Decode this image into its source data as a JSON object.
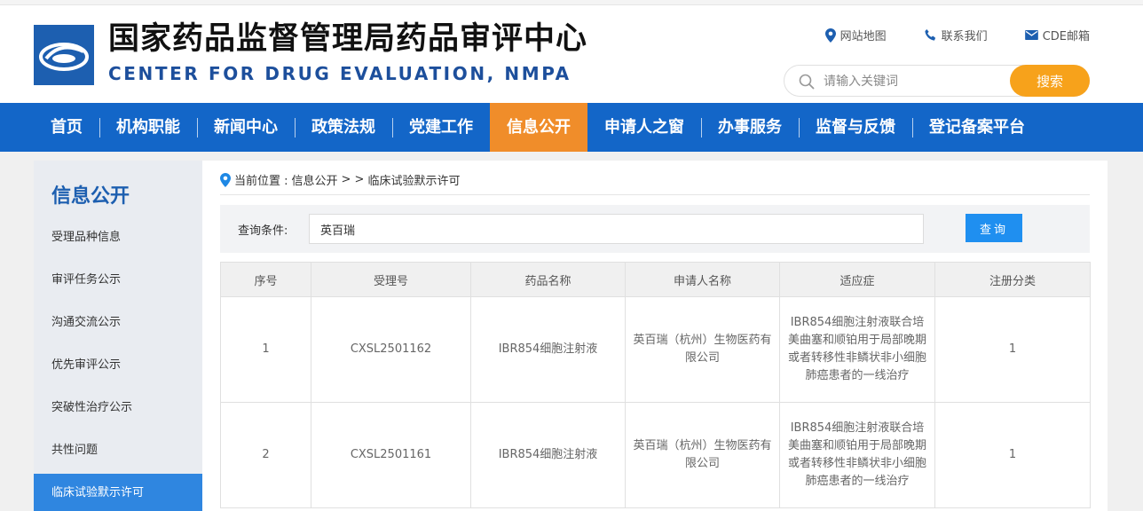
{
  "header": {
    "title_cn": "国家药品监督管理局药品审评中心",
    "title_en": "CENTER FOR DRUG EVALUATION, NMPA",
    "links": [
      {
        "label": "网站地图",
        "icon": "map-pin-icon"
      },
      {
        "label": "联系我们",
        "icon": "phone-icon"
      },
      {
        "label": "CDE邮箱",
        "icon": "mail-icon"
      }
    ],
    "search": {
      "placeholder": "请输入关键词",
      "button": "搜索"
    }
  },
  "nav": {
    "items": [
      "首页",
      "机构职能",
      "新闻中心",
      "政策法规",
      "党建工作",
      "信息公开",
      "申请人之窗",
      "办事服务",
      "监督与反馈",
      "登记备案平台"
    ],
    "active": "信息公开"
  },
  "sidebar": {
    "title": "信息公开",
    "items": [
      "受理品种信息",
      "审评任务公示",
      "沟通交流公示",
      "优先审评公示",
      "突破性治疗公示",
      "共性问题",
      "临床试验默示许可"
    ],
    "active": "临床试验默示许可"
  },
  "breadcrumb": {
    "prefix": "当前位置 : ",
    "section": "信息公开",
    "sep": " > > ",
    "page": "临床试验默示许可"
  },
  "query": {
    "label": "查询条件:",
    "value": "英百瑞",
    "button": "查询"
  },
  "table": {
    "headers": [
      "序号",
      "受理号",
      "药品名称",
      "申请人名称",
      "适应症",
      "注册分类"
    ],
    "rows": [
      [
        "1",
        "CXSL2501162",
        "IBR854细胞注射液",
        "英百瑞（杭州）生物医药有限公司",
        "IBR854细胞注射液联合培美曲塞和顺铂用于局部晚期或者转移性非鳞状非小细胞肺癌患者的一线治疗",
        "1"
      ],
      [
        "2",
        "CXSL2501161",
        "IBR854细胞注射液",
        "英百瑞（杭州）生物医药有限公司",
        "IBR854细胞注射液联合培美曲塞和顺铂用于局部晚期或者转移性非鳞状非小细胞肺癌患者的一线治疗",
        "1"
      ]
    ]
  },
  "colors": {
    "nav_blue": "#1366c8",
    "active_orange": "#f08d2a",
    "search_orange": "#f7a21b",
    "sidebar_active": "#2f86e0",
    "query_blue": "#1f8ff0"
  }
}
